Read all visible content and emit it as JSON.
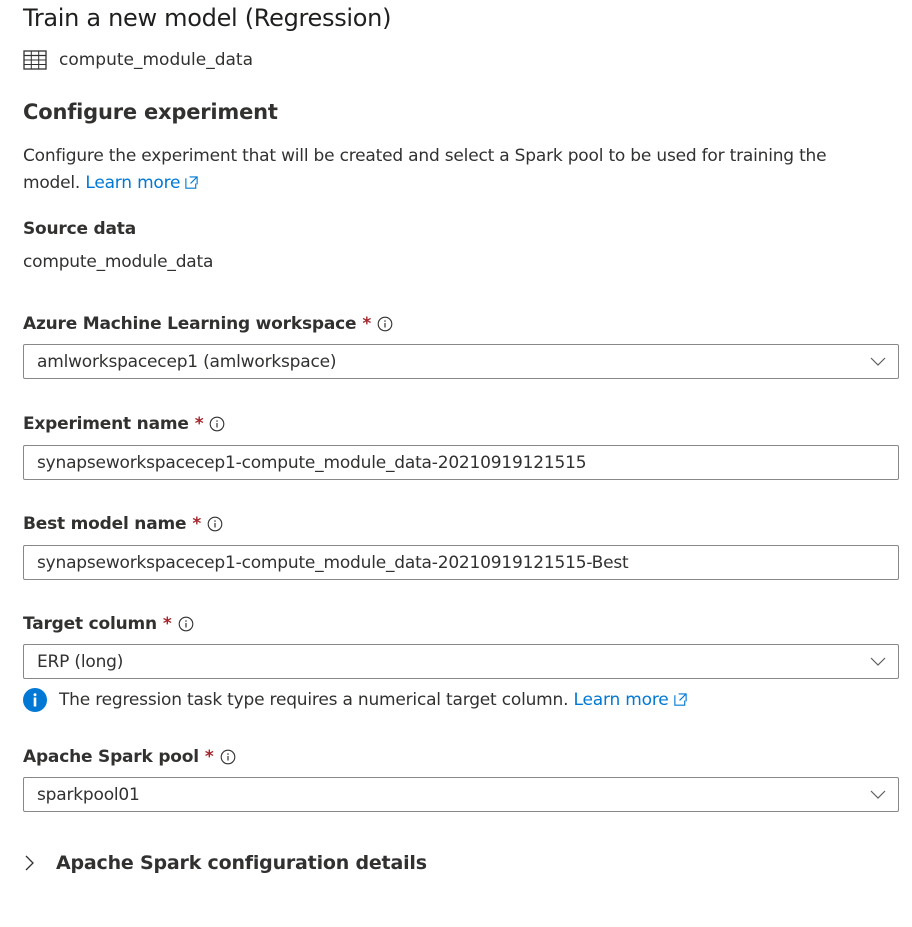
{
  "header": {
    "title": "Train a new model (Regression)",
    "dataset_name": "compute_module_data"
  },
  "configure": {
    "heading": "Configure experiment",
    "description": "Configure the experiment that will be created and select a Spark pool to be used for training the model.",
    "learn_more": "Learn more"
  },
  "source_data": {
    "label": "Source data",
    "value": "compute_module_data"
  },
  "workspace": {
    "label": "Azure Machine Learning workspace",
    "required": "*",
    "value": "amlworkspacecep1 (amlworkspace)"
  },
  "experiment_name": {
    "label": "Experiment name",
    "required": "*",
    "value": "synapseworkspacecep1-compute_module_data-20210919121515"
  },
  "best_model_name": {
    "label": "Best model name",
    "required": "*",
    "value": "synapseworkspacecep1-compute_module_data-20210919121515-Best"
  },
  "target_column": {
    "label": "Target column",
    "required": "*",
    "value": "ERP (long)",
    "info_message": "The regression task type requires a numerical target column.",
    "learn_more": "Learn more"
  },
  "spark_pool": {
    "label": "Apache Spark pool",
    "required": "*",
    "value": "sparkpool01"
  },
  "spark_config": {
    "label": "Apache Spark configuration details"
  },
  "colors": {
    "link": "#0078d4",
    "required": "#a4262c",
    "border": "#8a8886",
    "text": "#323130"
  }
}
